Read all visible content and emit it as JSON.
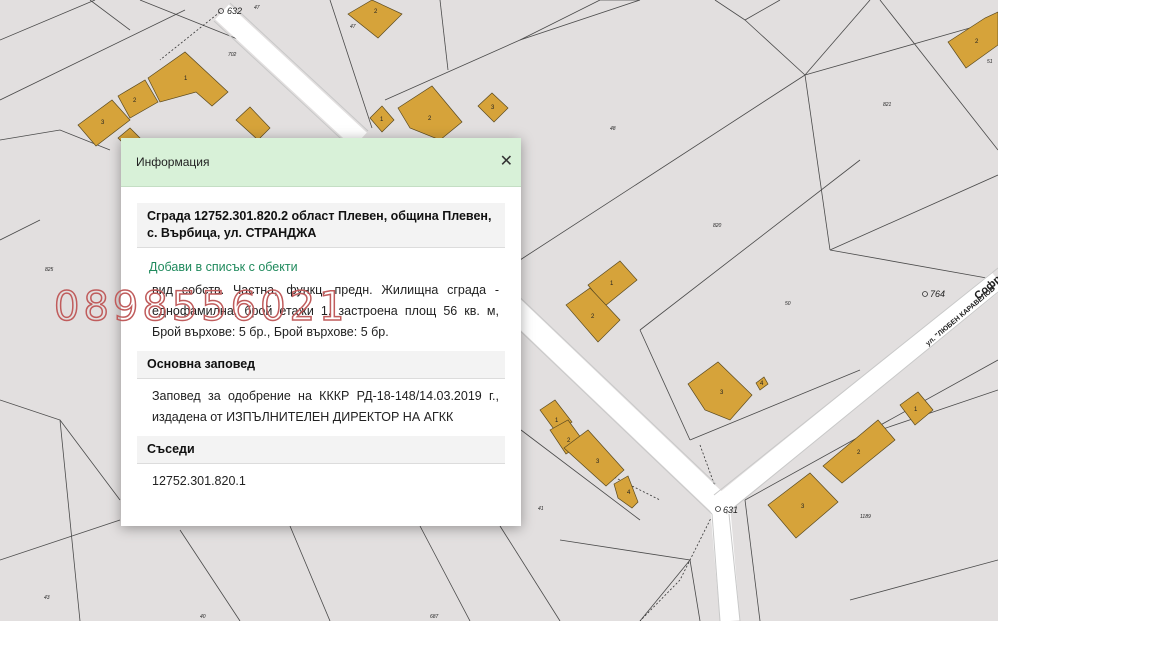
{
  "map": {
    "parcel_labels": [
      "632",
      "47",
      "702",
      "48",
      "821",
      "51",
      "825",
      "820",
      "50",
      "764",
      "631",
      "1189",
      "41",
      "43",
      "40",
      "687"
    ],
    "building_labels": [
      "1",
      "2",
      "3",
      "4"
    ],
    "street_name": "ул. \"ЛЮБЕН КАРАВЕЛОВ\"",
    "street_name_2": "Софр"
  },
  "watermark": "0898556021",
  "info_panel": {
    "title": "Информация",
    "close_label": "✕",
    "building_heading": "Сграда 12752.301.820.2 област Плевен, община Плевен, с. Върбица, ул. СТРАНДЖА",
    "add_to_list": "Добави в списък с обекти",
    "attributes": "вид собств. Частна, функц. предн. Жилищна сграда - еднофамилна, брой етажи 1, застроена площ 56 кв. м, Брой върхове: 5 бр., Брой върхове: 5 бр.",
    "order_heading": "Основна заповед",
    "order_text": "Заповед за одобрение на КККР РД-18-148/14.03.2019 г., издадена от ИЗПЪЛНИТЕЛЕН ДИРЕКТОР НА АГКК",
    "neighbors_heading": "Съседи",
    "neighbors": [
      "12752.301.820.1"
    ]
  },
  "colors": {
    "map_background": "#e2dfdf",
    "building_fill": "#d6a33a",
    "road": "#ffffff",
    "panel_header": "#d8f1d8",
    "link": "#208a5d",
    "watermark": "#c05c5c"
  }
}
